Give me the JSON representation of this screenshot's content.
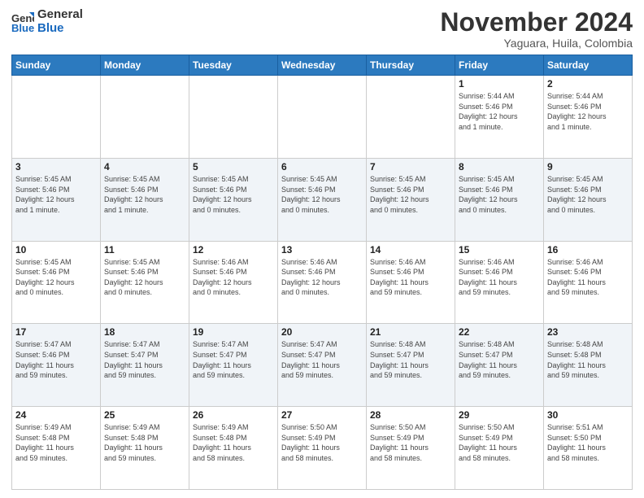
{
  "logo": {
    "line1": "General",
    "line2": "Blue"
  },
  "header": {
    "month_year": "November 2024",
    "location": "Yaguara, Huila, Colombia"
  },
  "weekdays": [
    "Sunday",
    "Monday",
    "Tuesday",
    "Wednesday",
    "Thursday",
    "Friday",
    "Saturday"
  ],
  "weeks": [
    [
      {
        "day": "",
        "info": ""
      },
      {
        "day": "",
        "info": ""
      },
      {
        "day": "",
        "info": ""
      },
      {
        "day": "",
        "info": ""
      },
      {
        "day": "",
        "info": ""
      },
      {
        "day": "1",
        "info": "Sunrise: 5:44 AM\nSunset: 5:46 PM\nDaylight: 12 hours\nand 1 minute."
      },
      {
        "day": "2",
        "info": "Sunrise: 5:44 AM\nSunset: 5:46 PM\nDaylight: 12 hours\nand 1 minute."
      }
    ],
    [
      {
        "day": "3",
        "info": "Sunrise: 5:45 AM\nSunset: 5:46 PM\nDaylight: 12 hours\nand 1 minute."
      },
      {
        "day": "4",
        "info": "Sunrise: 5:45 AM\nSunset: 5:46 PM\nDaylight: 12 hours\nand 1 minute."
      },
      {
        "day": "5",
        "info": "Sunrise: 5:45 AM\nSunset: 5:46 PM\nDaylight: 12 hours\nand 0 minutes."
      },
      {
        "day": "6",
        "info": "Sunrise: 5:45 AM\nSunset: 5:46 PM\nDaylight: 12 hours\nand 0 minutes."
      },
      {
        "day": "7",
        "info": "Sunrise: 5:45 AM\nSunset: 5:46 PM\nDaylight: 12 hours\nand 0 minutes."
      },
      {
        "day": "8",
        "info": "Sunrise: 5:45 AM\nSunset: 5:46 PM\nDaylight: 12 hours\nand 0 minutes."
      },
      {
        "day": "9",
        "info": "Sunrise: 5:45 AM\nSunset: 5:46 PM\nDaylight: 12 hours\nand 0 minutes."
      }
    ],
    [
      {
        "day": "10",
        "info": "Sunrise: 5:45 AM\nSunset: 5:46 PM\nDaylight: 12 hours\nand 0 minutes."
      },
      {
        "day": "11",
        "info": "Sunrise: 5:45 AM\nSunset: 5:46 PM\nDaylight: 12 hours\nand 0 minutes."
      },
      {
        "day": "12",
        "info": "Sunrise: 5:46 AM\nSunset: 5:46 PM\nDaylight: 12 hours\nand 0 minutes."
      },
      {
        "day": "13",
        "info": "Sunrise: 5:46 AM\nSunset: 5:46 PM\nDaylight: 12 hours\nand 0 minutes."
      },
      {
        "day": "14",
        "info": "Sunrise: 5:46 AM\nSunset: 5:46 PM\nDaylight: 11 hours\nand 59 minutes."
      },
      {
        "day": "15",
        "info": "Sunrise: 5:46 AM\nSunset: 5:46 PM\nDaylight: 11 hours\nand 59 minutes."
      },
      {
        "day": "16",
        "info": "Sunrise: 5:46 AM\nSunset: 5:46 PM\nDaylight: 11 hours\nand 59 minutes."
      }
    ],
    [
      {
        "day": "17",
        "info": "Sunrise: 5:47 AM\nSunset: 5:46 PM\nDaylight: 11 hours\nand 59 minutes."
      },
      {
        "day": "18",
        "info": "Sunrise: 5:47 AM\nSunset: 5:47 PM\nDaylight: 11 hours\nand 59 minutes."
      },
      {
        "day": "19",
        "info": "Sunrise: 5:47 AM\nSunset: 5:47 PM\nDaylight: 11 hours\nand 59 minutes."
      },
      {
        "day": "20",
        "info": "Sunrise: 5:47 AM\nSunset: 5:47 PM\nDaylight: 11 hours\nand 59 minutes."
      },
      {
        "day": "21",
        "info": "Sunrise: 5:48 AM\nSunset: 5:47 PM\nDaylight: 11 hours\nand 59 minutes."
      },
      {
        "day": "22",
        "info": "Sunrise: 5:48 AM\nSunset: 5:47 PM\nDaylight: 11 hours\nand 59 minutes."
      },
      {
        "day": "23",
        "info": "Sunrise: 5:48 AM\nSunset: 5:48 PM\nDaylight: 11 hours\nand 59 minutes."
      }
    ],
    [
      {
        "day": "24",
        "info": "Sunrise: 5:49 AM\nSunset: 5:48 PM\nDaylight: 11 hours\nand 59 minutes."
      },
      {
        "day": "25",
        "info": "Sunrise: 5:49 AM\nSunset: 5:48 PM\nDaylight: 11 hours\nand 59 minutes."
      },
      {
        "day": "26",
        "info": "Sunrise: 5:49 AM\nSunset: 5:48 PM\nDaylight: 11 hours\nand 58 minutes."
      },
      {
        "day": "27",
        "info": "Sunrise: 5:50 AM\nSunset: 5:49 PM\nDaylight: 11 hours\nand 58 minutes."
      },
      {
        "day": "28",
        "info": "Sunrise: 5:50 AM\nSunset: 5:49 PM\nDaylight: 11 hours\nand 58 minutes."
      },
      {
        "day": "29",
        "info": "Sunrise: 5:50 AM\nSunset: 5:49 PM\nDaylight: 11 hours\nand 58 minutes."
      },
      {
        "day": "30",
        "info": "Sunrise: 5:51 AM\nSunset: 5:50 PM\nDaylight: 11 hours\nand 58 minutes."
      }
    ]
  ]
}
